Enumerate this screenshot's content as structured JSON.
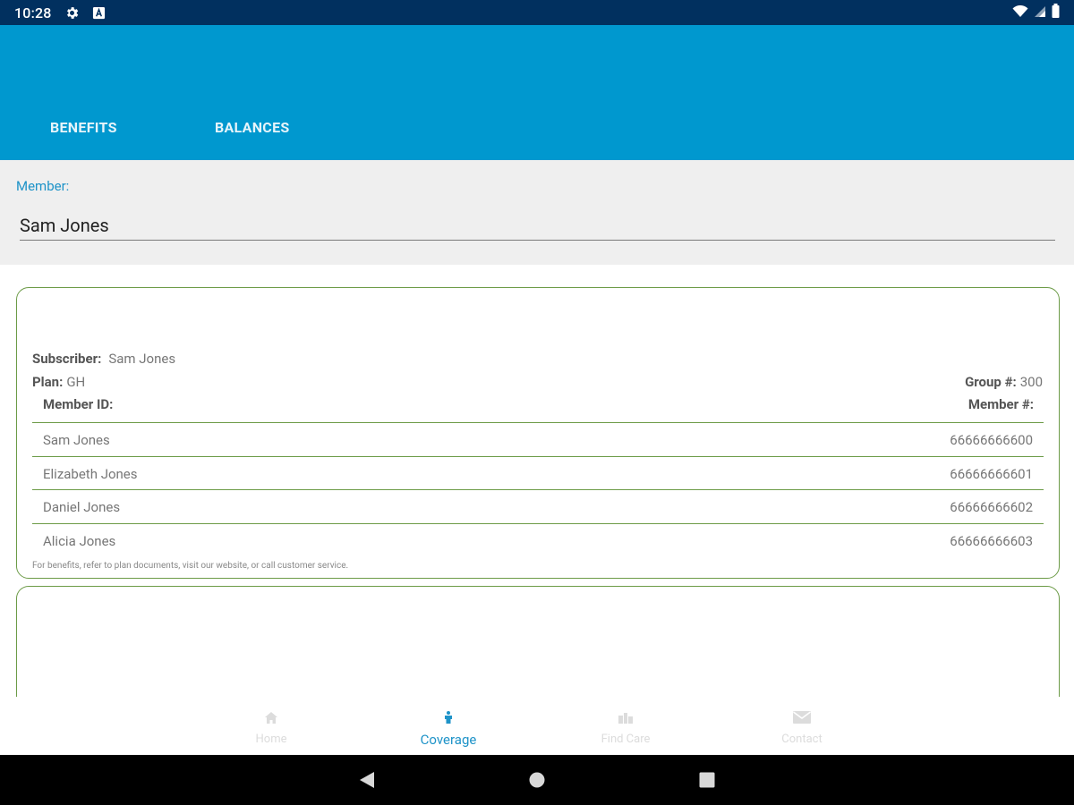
{
  "status_bar": {
    "time": "10:28"
  },
  "tabs": [
    {
      "label": "BENEFITS"
    },
    {
      "label": "BALANCES"
    }
  ],
  "member": {
    "label": "Member:",
    "selected": "Sam Jones"
  },
  "card": {
    "subscriber_label": "Subscriber:",
    "subscriber_value": "Sam Jones",
    "plan_label": "Plan:",
    "plan_value": "GH",
    "group_label": "Group #:",
    "group_value": "300",
    "col_member_id": "Member ID:",
    "col_member_num": "Member #:",
    "rows": [
      {
        "name": "Sam Jones",
        "number": "66666666600"
      },
      {
        "name": "Elizabeth Jones",
        "number": "66666666601"
      },
      {
        "name": "Daniel Jones",
        "number": "66666666602"
      },
      {
        "name": "Alicia Jones",
        "number": "66666666603"
      }
    ],
    "footnote": "For benefits, refer to plan documents, visit our website, or call customer service."
  },
  "bottom_nav": [
    {
      "label": "Home",
      "icon": "home-icon",
      "active": false
    },
    {
      "label": "Coverage",
      "icon": "coverage-icon",
      "active": true
    },
    {
      "label": "Find Care",
      "icon": "find-care-icon",
      "active": false
    },
    {
      "label": "Contact",
      "icon": "mail-icon",
      "active": false
    }
  ],
  "colors": {
    "status_bar": "#01305f",
    "app_bar": "#0098cf",
    "accent": "#1e93c8",
    "card_border": "#6c9b47",
    "panel_bg": "#efefef"
  }
}
